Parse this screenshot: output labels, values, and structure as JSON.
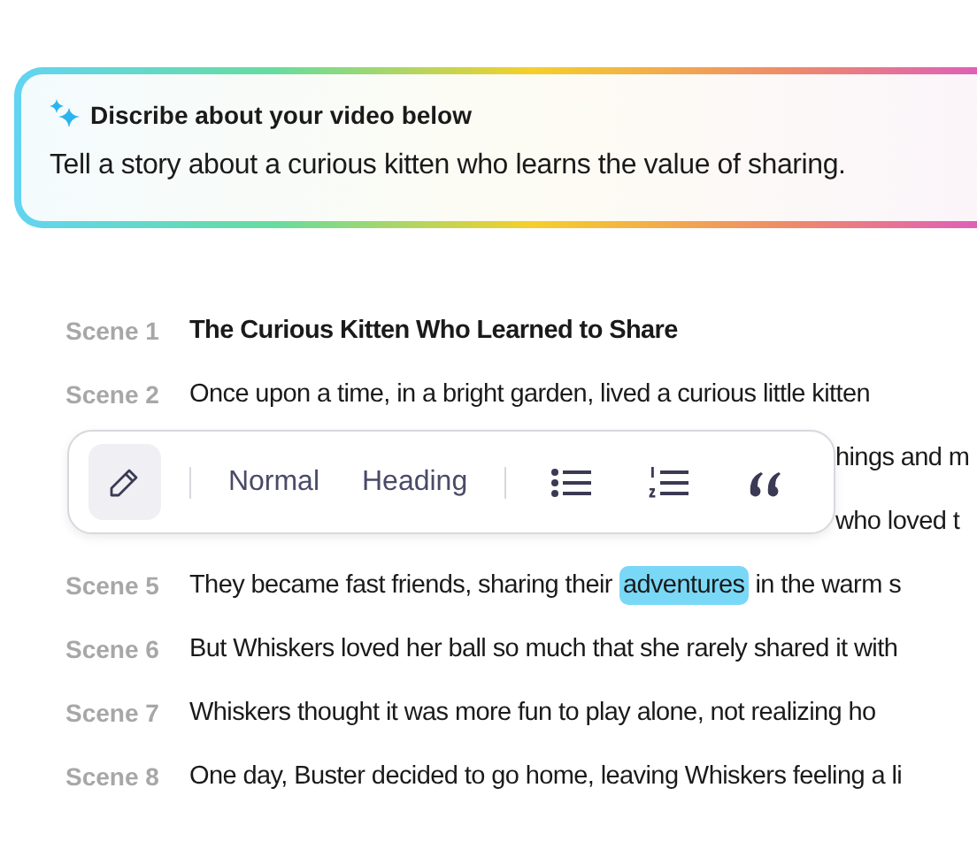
{
  "prompt_card": {
    "title": "Discribe about your video below",
    "text": "Tell a story about a curious kitten who learns the value of sharing."
  },
  "scenes": [
    {
      "label": "Scene 1",
      "kind": "title",
      "segments": [
        {
          "text": "The Curious Kitten Who Learned to Share",
          "highlighted": false
        }
      ]
    },
    {
      "label": "Scene 2",
      "kind": "line",
      "segments": [
        {
          "text": "Once upon a time, in a bright garden, lived a curious little kitten",
          "highlighted": false
        }
      ]
    },
    {
      "kind": "covered",
      "segments": [
        {
          "text": "hings and m",
          "highlighted": false
        }
      ]
    },
    {
      "kind": "covered",
      "segments": [
        {
          "text": "who loved t",
          "highlighted": false
        }
      ]
    },
    {
      "label": "Scene 5",
      "kind": "line",
      "segments": [
        {
          "text": "They became fast friends, sharing their",
          "highlighted": false
        },
        {
          "text": "adventures",
          "highlighted": true
        },
        {
          "text": "in the warm s",
          "highlighted": false
        }
      ]
    },
    {
      "label": "Scene 6",
      "kind": "line",
      "segments": [
        {
          "text": "But Whiskers loved her ball so much that she rarely shared it with",
          "highlighted": false
        }
      ]
    },
    {
      "label": "Scene 7",
      "kind": "line",
      "segments": [
        {
          "text": "Whiskers thought it was more fun to play alone, not realizing ho",
          "highlighted": false
        }
      ]
    },
    {
      "label": "Scene 8",
      "kind": "line",
      "segments": [
        {
          "text": "One day, Buster decided to go home, leaving Whiskers feeling a li",
          "highlighted": false
        }
      ]
    }
  ],
  "toolbar": [
    {
      "kind": "pencil",
      "selected": true
    },
    {
      "kind": "separator"
    },
    {
      "kind": "text",
      "label": "Normal",
      "selected": false
    },
    {
      "kind": "text",
      "label": "Heading",
      "selected": false
    },
    {
      "kind": "separator"
    },
    {
      "kind": "bullets",
      "selected": false
    },
    {
      "kind": "numbers",
      "selected": false
    },
    {
      "kind": "quote",
      "selected": false
    }
  ]
}
